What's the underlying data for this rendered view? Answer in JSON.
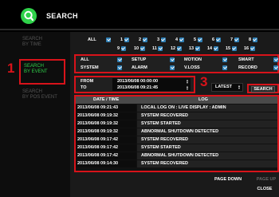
{
  "app": {
    "title": "SEARCH",
    "logo_icon": "search-logo-icon"
  },
  "sidebar": {
    "items": [
      {
        "label": "SEARCH\nBY TIME",
        "active": false
      },
      {
        "label": "SEARCH\nBY EVENT",
        "active": true
      },
      {
        "label": "SEARCH\nBY POS EVENT",
        "active": false
      }
    ]
  },
  "callouts": {
    "one": "1",
    "three": "3"
  },
  "channels": {
    "all_label": "ALL",
    "row1": [
      "1",
      "2",
      "3",
      "4",
      "5",
      "6",
      "7",
      "8"
    ],
    "row2": [
      "9",
      "10",
      "11",
      "12",
      "13",
      "14",
      "15",
      "16"
    ],
    "check_color": "#2f7fb5"
  },
  "filters": {
    "row1": [
      "ALL",
      "SETUP",
      "MOTION",
      "SMART"
    ],
    "row2": [
      "SYSTEM",
      "ALARM",
      "V.LOSS",
      "RECORD"
    ]
  },
  "range": {
    "from_label": "FROM",
    "from_value": "2013/06/08 00:00:00",
    "to_label": "TO",
    "to_value": "2013/06/08 09:21:45"
  },
  "sort": {
    "selected": "LATEST"
  },
  "buttons": {
    "search": "SEARCH",
    "page_down": "PAGE DOWN",
    "page_up": "PAGE UP",
    "close": "CLOSE"
  },
  "log": {
    "headers": {
      "datetime": "DATE / TIME",
      "log": "LOG"
    },
    "rows": [
      {
        "datetime": "2013/06/08 09:21:43",
        "log": "LOCAL LOG ON : LIVE DISPLAY : ADMIN"
      },
      {
        "datetime": "2013/06/08 09:19:32",
        "log": "SYSTEM RECOVERED"
      },
      {
        "datetime": "2013/06/08 09:19:32",
        "log": "SYSTEM STARTED"
      },
      {
        "datetime": "2013/06/08 09:19:32",
        "log": "ABNORMAL SHUTDOWN DETECTED"
      },
      {
        "datetime": "2013/06/08 09:17:42",
        "log": "SYSTEM RECOVERED"
      },
      {
        "datetime": "2013/06/08 09:17:42",
        "log": "SYSTEM STARTED"
      },
      {
        "datetime": "2013/06/08 09:17:42",
        "log": "ABNORMAL SHUTDOWN DETECTED"
      },
      {
        "datetime": "2013/06/08 09:14:30",
        "log": "SYSTEM RECOVERED"
      }
    ]
  },
  "colors": {
    "accent_red": "#d8131a",
    "active_green": "#2fd24a"
  }
}
